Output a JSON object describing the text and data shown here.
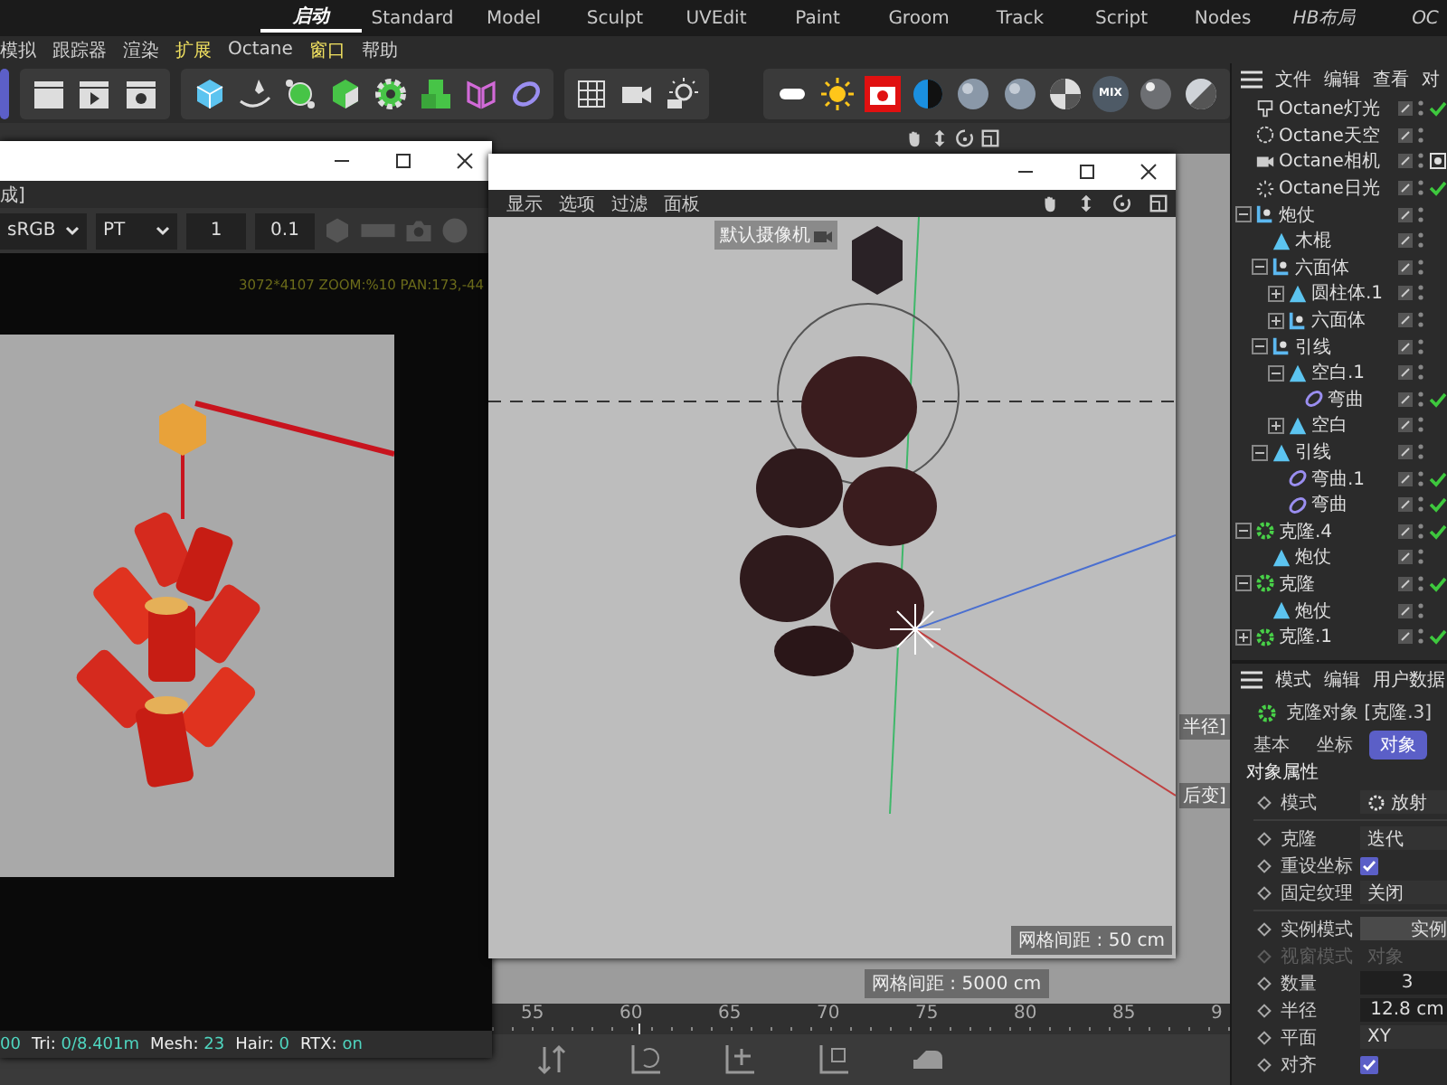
{
  "layouts": [
    {
      "label": "启动",
      "selected": true,
      "custom": true
    },
    {
      "label": "Standard",
      "selected": false,
      "custom": false
    },
    {
      "label": "Model",
      "selected": false,
      "custom": false
    },
    {
      "label": "Sculpt",
      "selected": false,
      "custom": false
    },
    {
      "label": "UVEdit",
      "selected": false,
      "custom": false
    },
    {
      "label": "Paint",
      "selected": false,
      "custom": false
    },
    {
      "label": "Groom",
      "selected": false,
      "custom": false
    },
    {
      "label": "Track",
      "selected": false,
      "custom": false
    },
    {
      "label": "Script",
      "selected": false,
      "custom": false
    },
    {
      "label": "Nodes",
      "selected": false,
      "custom": false
    },
    {
      "label": "HB布局",
      "selected": false,
      "custom": true
    },
    {
      "label": "OC",
      "selected": false,
      "custom": true
    }
  ],
  "menu": [
    {
      "label": "模拟",
      "highlight": false
    },
    {
      "label": "跟踪器",
      "highlight": false
    },
    {
      "label": "渲染",
      "highlight": false
    },
    {
      "label": "扩展",
      "highlight": true
    },
    {
      "label": "Octane",
      "highlight": false
    },
    {
      "label": "窗口",
      "highlight": true
    },
    {
      "label": "帮助",
      "highlight": false
    }
  ],
  "octane_toolbar": {
    "mix_label": "MIX"
  },
  "render_window": {
    "menu_text": "成]",
    "color_space": "sRGB",
    "kernel": "PT",
    "field_1": "1",
    "field_2": "0.1",
    "info": "3072*4107 ZOOM:%10  PAN:173,-44",
    "status_lead": "00",
    "status": [
      {
        "label": "Tri:",
        "value": "0/8.401m"
      },
      {
        "label": "Mesh:",
        "value": "23"
      },
      {
        "label": "Hair:",
        "value": "0"
      },
      {
        "label": "RTX:",
        "value": "on"
      }
    ]
  },
  "viewport_window": {
    "menu": [
      "显示",
      "选项",
      "过滤",
      "面板"
    ],
    "camera_label": "默认摄像机",
    "grid_label": "网格间距 : 50 cm"
  },
  "background_viewport": {
    "grid_label": "网格间距 : 5000 cm",
    "side_labels": [
      "半径]",
      "后变]"
    ]
  },
  "timeline": {
    "ticks": [
      "55",
      "60",
      "65",
      "70",
      "75",
      "80",
      "85",
      "9"
    ]
  },
  "object_manager": {
    "menu": [
      "文件",
      "编辑",
      "查看",
      "对"
    ],
    "objects": [
      {
        "name": "Octane灯光",
        "kind": "light",
        "checked": true
      },
      {
        "name": "Octane天空",
        "kind": "sky",
        "checked": false
      },
      {
        "name": "Octane相机",
        "kind": "camera",
        "checked": false
      },
      {
        "name": "Octane日光",
        "kind": "sun",
        "checked": true
      },
      {
        "name": "炮仗",
        "kind": "null",
        "checked": false,
        "expanded": true,
        "children": [
          {
            "name": "木棍",
            "kind": "figure",
            "checked": false
          },
          {
            "name": "六面体",
            "kind": "null",
            "checked": false,
            "expanded": true,
            "children": [
              {
                "name": "圆柱体.1",
                "kind": "figure",
                "checked": false,
                "expanded": false
              },
              {
                "name": "六面体",
                "kind": "null",
                "checked": false,
                "expanded": false
              }
            ]
          },
          {
            "name": "引线",
            "kind": "null",
            "checked": false,
            "expanded": true,
            "children": [
              {
                "name": "空白.1",
                "kind": "figure",
                "checked": false,
                "expanded": true,
                "children": [
                  {
                    "name": "弯曲",
                    "kind": "bend",
                    "checked": true
                  }
                ]
              },
              {
                "name": "空白",
                "kind": "figure",
                "checked": false,
                "expanded": false
              }
            ]
          },
          {
            "name": "引线",
            "kind": "figure",
            "checked": false,
            "expanded": true,
            "children": [
              {
                "name": "弯曲.1",
                "kind": "bend",
                "checked": true
              },
              {
                "name": "弯曲",
                "kind": "bend",
                "checked": true
              }
            ]
          }
        ]
      },
      {
        "name": "克隆.4",
        "kind": "cloner",
        "checked": true,
        "expanded": true,
        "children": [
          {
            "name": "炮仗",
            "kind": "figure",
            "checked": false
          }
        ]
      },
      {
        "name": "克隆",
        "kind": "cloner",
        "checked": true,
        "expanded": true,
        "children": [
          {
            "name": "炮仗",
            "kind": "figure",
            "checked": false
          }
        ]
      },
      {
        "name": "克隆.1",
        "kind": "cloner",
        "checked": true,
        "expanded": false
      }
    ]
  },
  "attributes": {
    "menu": [
      "模式",
      "编辑",
      "用户数据"
    ],
    "title": "克隆对象 [克隆.3]",
    "tabs": [
      {
        "label": "基本",
        "selected": false
      },
      {
        "label": "坐标",
        "selected": false
      },
      {
        "label": "对象",
        "selected": true
      }
    ],
    "section": "对象属性",
    "fields": [
      {
        "kind": "dropdown",
        "label": "模式",
        "value": "放射",
        "has_icon": true,
        "disabled": false
      },
      {
        "kind": "divider"
      },
      {
        "kind": "dropdown",
        "label": "克隆",
        "value": "迭代",
        "disabled": false
      },
      {
        "kind": "checkbox",
        "label": "重设坐标",
        "checked": true,
        "disabled": false
      },
      {
        "kind": "dropdown",
        "label": "固定纹理",
        "value": "关闭",
        "disabled": false
      },
      {
        "kind": "divider"
      },
      {
        "kind": "button",
        "label": "实例模式",
        "value": "实例",
        "disabled": false
      },
      {
        "kind": "text",
        "label": "视窗模式",
        "value": "对象",
        "disabled": true
      },
      {
        "kind": "number",
        "label": "数量",
        "value": "3",
        "disabled": false
      },
      {
        "kind": "number",
        "label": "半径",
        "value": "12.8 cm",
        "disabled": false
      },
      {
        "kind": "dropdown",
        "label": "平面",
        "value": "XY",
        "disabled": false
      },
      {
        "kind": "checkbox",
        "label": "对齐",
        "checked": true,
        "disabled": false
      }
    ]
  }
}
